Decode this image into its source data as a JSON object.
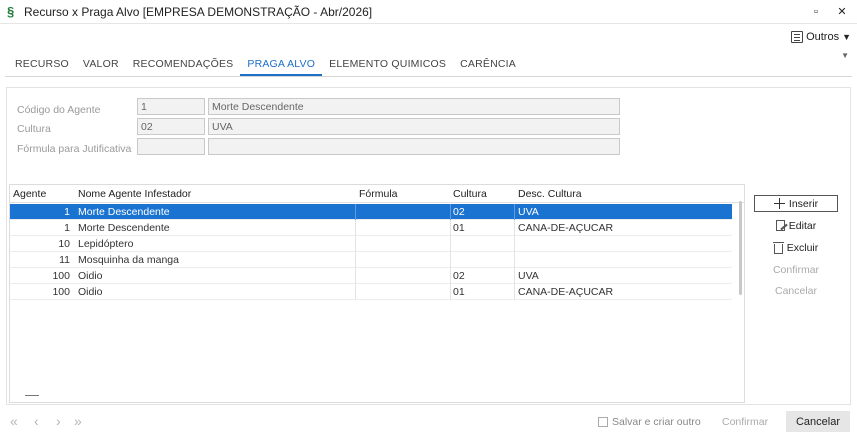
{
  "window": {
    "title": "Recurso x Praga Alvo [EMPRESA DEMONSTRAÇÃO - Abr/2026]",
    "minimize": "▫",
    "close": "✕"
  },
  "toolbar": {
    "outros_label": "Outros"
  },
  "tabs": [
    {
      "label": "RECURSO"
    },
    {
      "label": "VALOR"
    },
    {
      "label": "RECOMENDAÇÕES"
    },
    {
      "label": "PRAGA ALVO",
      "active": true
    },
    {
      "label": "ELEMENTO QUIMICOS"
    },
    {
      "label": "CARÊNCIA"
    }
  ],
  "form": {
    "codigo_label": "Código do Agente",
    "codigo_value": "1",
    "codigo_desc": "Morte Descendente",
    "cultura_label": "Cultura",
    "cultura_value": "02",
    "cultura_desc": "UVA",
    "formula_label": "Fórmula para Jutificativa",
    "formula_value": "",
    "formula_desc": ""
  },
  "grid": {
    "columns": [
      "Agente",
      "Nome Agente Infestador",
      "Fórmula",
      "Cultura",
      "Desc. Cultura"
    ],
    "rows": [
      {
        "agente": "1",
        "nome": "Morte Descendente",
        "formula": "",
        "cultura": "02",
        "desc": "UVA",
        "selected": true
      },
      {
        "agente": "1",
        "nome": "Morte Descendente",
        "formula": "",
        "cultura": "01",
        "desc": "CANA-DE-AÇUCAR"
      },
      {
        "agente": "10",
        "nome": "Lepidóptero",
        "formula": "",
        "cultura": "",
        "desc": ""
      },
      {
        "agente": "11",
        "nome": "Mosquinha da manga",
        "formula": "",
        "cultura": "",
        "desc": ""
      },
      {
        "agente": "100",
        "nome": "Oidio",
        "formula": "",
        "cultura": "02",
        "desc": "UVA"
      },
      {
        "agente": "100",
        "nome": "Oidio",
        "formula": "",
        "cultura": "01",
        "desc": "CANA-DE-AÇUCAR"
      }
    ]
  },
  "actions": {
    "inserir": "Inserir",
    "editar": "Editar",
    "excluir": "Excluir",
    "confirmar": "Confirmar",
    "cancelar": "Cancelar"
  },
  "bottom": {
    "nav_first": "«",
    "nav_prev": "‹",
    "nav_next": "›",
    "nav_last": "»",
    "salvar_criar": "Salvar e criar outro",
    "confirmar": "Confirmar",
    "cancelar": "Cancelar"
  }
}
